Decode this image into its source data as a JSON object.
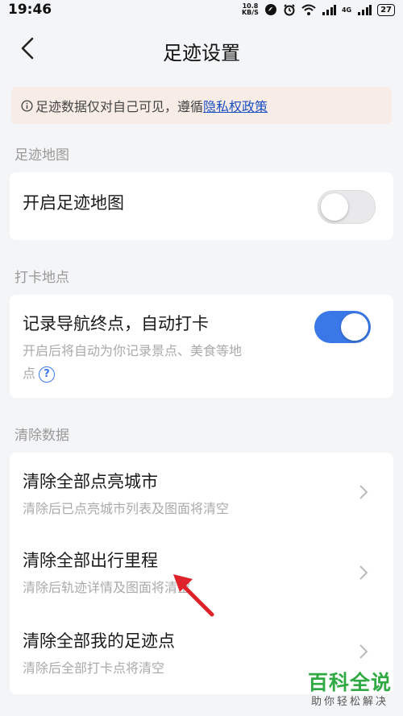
{
  "status_bar": {
    "time": "19:46",
    "net_speed_value": "10.8",
    "net_speed_unit": "KB/S",
    "network_type": "4G",
    "battery": "27"
  },
  "nav": {
    "title": "足迹设置"
  },
  "notice": {
    "icon": "info-icon",
    "text": "足迹数据仅对自己可见，遵循",
    "link": "隐私权政策"
  },
  "sections": {
    "footprint_map": {
      "label": "足迹地图",
      "row_title": "开启足迹地图",
      "toggle_on": false
    },
    "checkin": {
      "label": "打卡地点",
      "row_title": "记录导航终点，自动打卡",
      "row_sub_line1": "开启后将自动为你记录景点、美食等地",
      "row_sub_line2": "点",
      "help_icon": "?",
      "toggle_on": true
    },
    "clear": {
      "label": "清除数据",
      "items": [
        {
          "title": "清除全部点亮城市",
          "sub": "清除后已点亮城市列表及图面将清空"
        },
        {
          "title": "清除全部出行里程",
          "sub": "清除后轨迹详情及图面将清空"
        },
        {
          "title": "清除全部我的足迹点",
          "sub": "清除后全部打卡点将清空"
        }
      ]
    }
  },
  "watermark": {
    "main": "百科全说",
    "sub": "助你轻松解决"
  },
  "colors": {
    "accent": "#3a78e8",
    "toggle_off": "#e9e9ec",
    "annotation_red": "#e0222a",
    "watermark_green": "#2faa42"
  }
}
